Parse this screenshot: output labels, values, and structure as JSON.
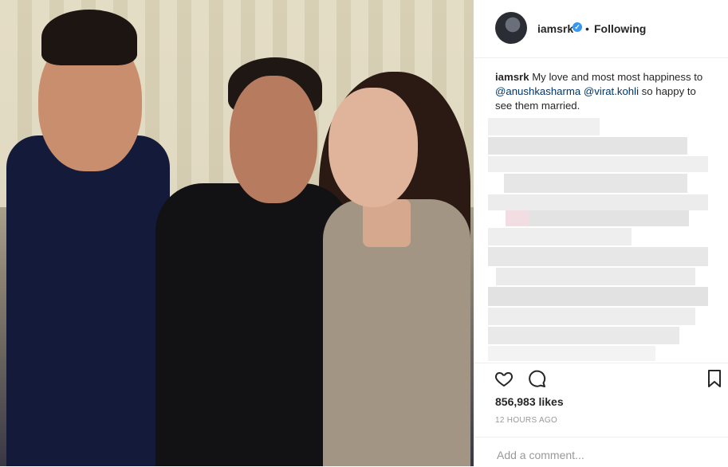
{
  "post": {
    "username": "iamsrk",
    "verified_mark": "✓",
    "separator": "•",
    "follow_status": "Following",
    "caption": {
      "username": "iamsrk",
      "text_1": " My love and most most happiness to ",
      "mention_1": "@anushkasharma",
      "text_2": " ",
      "mention_2": "@virat.kohli",
      "text_3": " so happy to see them married."
    },
    "likes": "856,983 likes",
    "timestamp": "12 HOURS AGO",
    "comment_placeholder": "Add a comment..."
  },
  "icons": {
    "like": "heart-icon",
    "comment": "comment-bubble-icon",
    "save": "bookmark-icon",
    "verified": "verified-badge-icon"
  },
  "colors": {
    "mention": "#003569",
    "verified": "#3897f0",
    "muted": "#999999",
    "text": "#262626"
  }
}
